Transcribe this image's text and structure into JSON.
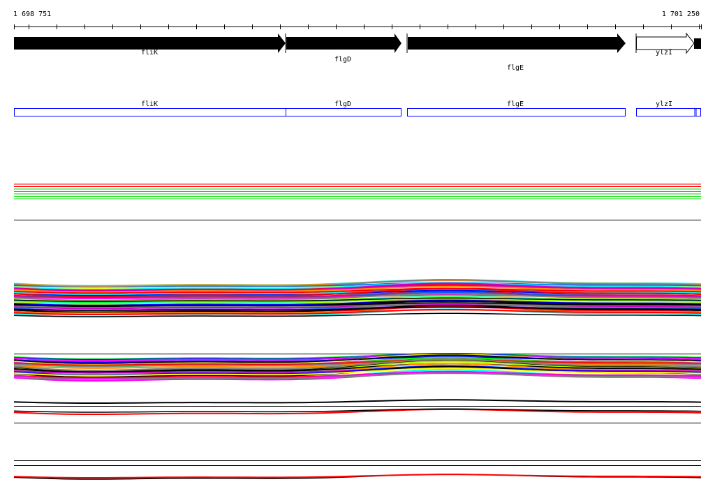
{
  "ruler": {
    "start_label": "1 698 751",
    "end_label": "1 701 250"
  },
  "genes": [
    {
      "name": "fliK",
      "strand": "+",
      "fill": "#000000"
    },
    {
      "name": "flgD",
      "strand": "+",
      "fill": "#000000"
    },
    {
      "name": "flgE",
      "strand": "+",
      "fill": "#000000"
    },
    {
      "name": "ylzI",
      "strand": "+",
      "fill": "#ffffff"
    }
  ],
  "annotation_track": {
    "color": "#0000ff",
    "labels": [
      "fliK",
      "flgD",
      "flgE",
      "ylzI"
    ]
  },
  "palette": [
    "#ff00ff",
    "#00ffff",
    "#ff0000",
    "#00ff00",
    "#0000ff",
    "#ffff00",
    "#ff8c00",
    "#808080",
    "#000000",
    "#0066ff",
    "#aaff00",
    "#cc00cc"
  ]
}
